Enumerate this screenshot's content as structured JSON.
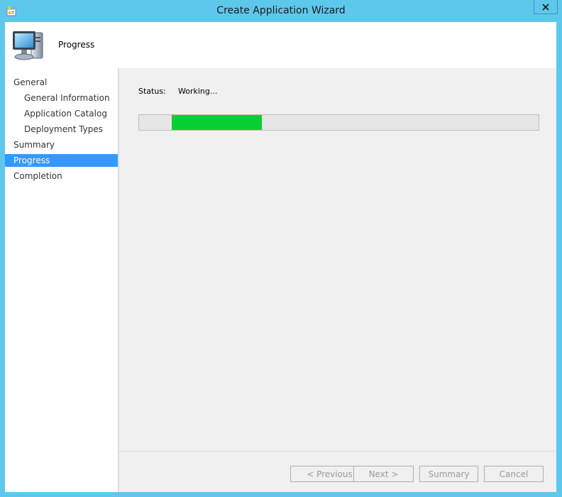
{
  "window": {
    "title": "Create Application Wizard",
    "close_glyph": "✕"
  },
  "header": {
    "title": "Progress",
    "icon": "computer-icon"
  },
  "sidebar": {
    "items": [
      {
        "label": "General",
        "level": 1,
        "selected": false
      },
      {
        "label": "General Information",
        "level": 2,
        "selected": false
      },
      {
        "label": "Application Catalog",
        "level": 2,
        "selected": false
      },
      {
        "label": "Deployment Types",
        "level": 2,
        "selected": false
      },
      {
        "label": "Summary",
        "level": 1,
        "selected": false
      },
      {
        "label": "Progress",
        "level": 1,
        "selected": true
      },
      {
        "label": "Completion",
        "level": 1,
        "selected": false
      }
    ]
  },
  "main": {
    "status_label": "Status:",
    "status_value": "Working...",
    "progress": {
      "style": "marquee",
      "color": "#06d034"
    }
  },
  "buttons": {
    "previous": "< Previous",
    "next": "Next >",
    "summary": "Summary",
    "cancel": "Cancel"
  },
  "colors": {
    "frame": "#5ec8ec",
    "selection": "#3399ff",
    "progress": "#06d034"
  }
}
